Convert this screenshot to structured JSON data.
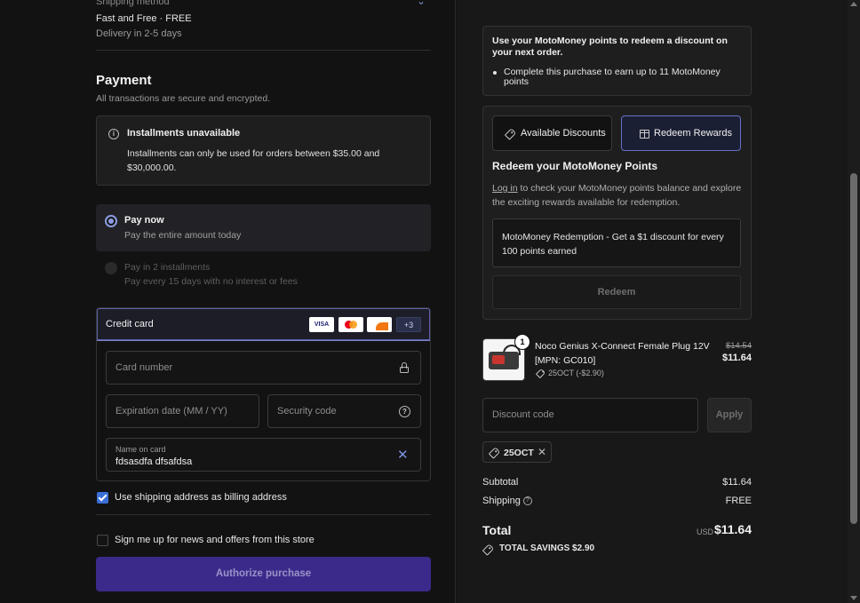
{
  "shipping": {
    "label": "Shipping method",
    "method": "Fast and Free · FREE",
    "delivery": "Delivery in 2-5 days"
  },
  "payment": {
    "title": "Payment",
    "subtitle": "All transactions are secure and encrypted.",
    "installments_notice": {
      "title": "Installments unavailable",
      "text": "Installments can only be used for orders between $35.00 and $30,000.00."
    },
    "options": [
      {
        "title": "Pay now",
        "subtitle": "Pay the entire amount today",
        "selected": true
      },
      {
        "title": "Pay in 2 installments",
        "subtitle": "Pay every 15 days with no interest or fees",
        "selected": false
      }
    ],
    "credit_card": {
      "label": "Credit card",
      "logos": [
        "VISA",
        "mastercard",
        "discover"
      ],
      "more_badge": "+3",
      "card_number_placeholder": "Card number",
      "expiration_placeholder": "Expiration date (MM / YY)",
      "security_placeholder": "Security code",
      "name_label": "Name on card",
      "name_value": "fdsasdfa dfsafdsa"
    },
    "billing_checkbox": {
      "label": "Use shipping address as billing address",
      "checked": true
    },
    "news_checkbox": {
      "label": "Sign me up for news and offers from this store",
      "checked": false
    },
    "authorize_button": "Authorize purchase"
  },
  "motomoney": {
    "title": "Use your MotoMoney points to redeem a discount on your next order.",
    "bullet": "Complete this purchase to earn up to 11 MotoMoney points"
  },
  "rewards": {
    "tab_discounts": "Available Discounts",
    "tab_redeem": "Redeem Rewards",
    "title": "Redeem your MotoMoney Points",
    "login_link": "Log in",
    "text_after_login": " to check your MotoMoney points balance and explore the exciting rewards available for redemption.",
    "option": "MotoMoney Redemption - Get a $1 discount for every 100 points earned",
    "redeem_button": "Redeem"
  },
  "cart": {
    "item": {
      "quantity": "1",
      "name": "Noco Genius X-Connect Female Plug 12V [MPN: GC010]",
      "discount": "25OCT (-$2.90)",
      "original_price": "$14.54",
      "price": "$11.64"
    },
    "discount_placeholder": "Discount code",
    "apply_button": "Apply",
    "applied_code": "25OCT"
  },
  "summary": {
    "subtotal_label": "Subtotal",
    "subtotal": "$11.64",
    "shipping_label": "Shipping",
    "shipping": "FREE",
    "total_label": "Total",
    "currency": "USD",
    "total": "$11.64",
    "savings": "TOTAL SAVINGS  $2.90"
  },
  "colors": {
    "accent": "#3b2a8a",
    "link_blue": "#7b92e0",
    "checkbox_blue": "#3b6fd8"
  }
}
